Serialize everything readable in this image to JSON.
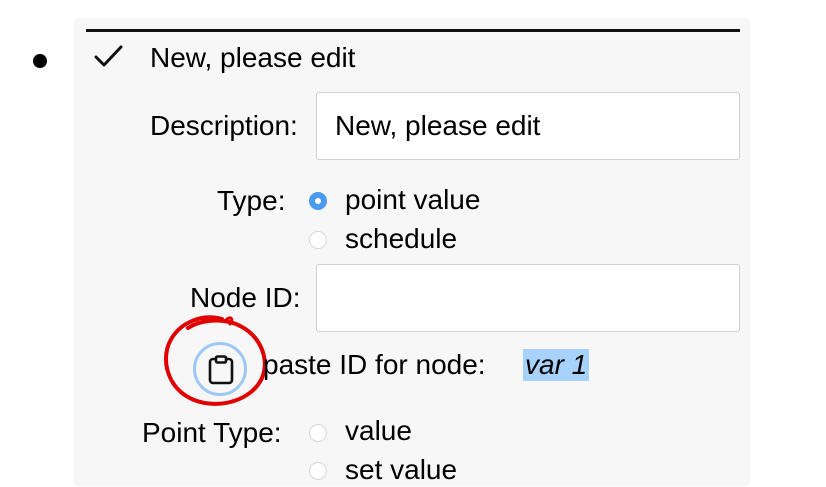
{
  "item": {
    "title": "New, please edit",
    "description_label": "Description:",
    "description_value": "New, please edit",
    "type_label": "Type:",
    "type_options": [
      {
        "label": "point value",
        "selected": true
      },
      {
        "label": "schedule",
        "selected": false
      }
    ],
    "node_id_label": "Node ID:",
    "node_id_value": "",
    "paste_label": "paste ID for node:",
    "paste_node": "var 1",
    "point_type_label": "Point Type:",
    "point_type_options": [
      {
        "label": "value",
        "selected": false
      },
      {
        "label": "set value",
        "selected": false
      }
    ]
  },
  "icons": {
    "expand": "check-icon",
    "paste": "clipboard-icon"
  },
  "colors": {
    "accent": "#4a9af0",
    "highlight": "#a6d2fb",
    "annotation": "#e00000"
  }
}
